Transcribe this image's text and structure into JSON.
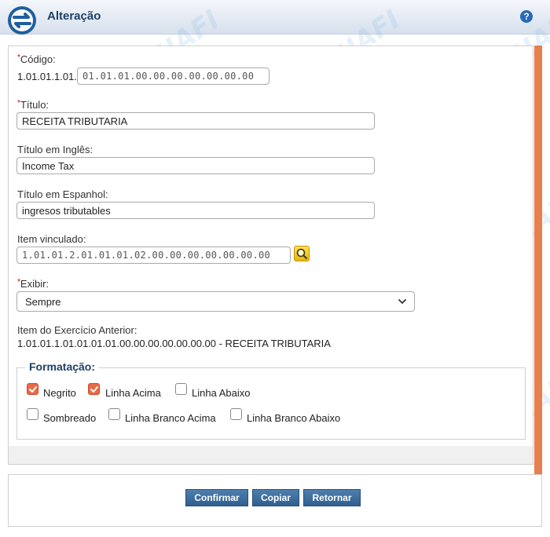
{
  "header": {
    "title": "Alteração",
    "help_label": "?"
  },
  "brand": {
    "watermark_text": "SIAFI",
    "accent_color": "#e87f4f",
    "title_color": "#1f3f66"
  },
  "form": {
    "codigo": {
      "label": "Código:",
      "prefix": "1.01.01.1.01.",
      "value": "01.01.01.00.00.00.00.00.00.00"
    },
    "titulo": {
      "label": "Título:",
      "value": "RECEITA TRIBUTARIA"
    },
    "titulo_ingles": {
      "label": "Título em Inglês:",
      "value": "Income Tax"
    },
    "titulo_espanhol": {
      "label": "Título em Espanhol:",
      "value": "ingresos tributables"
    },
    "item_vinculado": {
      "label": "Item vinculado:",
      "value": "1.01.01.2.01.01.01.02.00.00.00.00.00.00.00"
    },
    "exibir": {
      "label": "Exibir:",
      "value": "Sempre"
    },
    "item_anterior": {
      "label": "Item do Exercício Anterior:",
      "value": "1.01.01.1.01.01.01.01.00.00.00.00.00.00.00 - RECEITA TRIBUTARIA"
    },
    "required_mark": "*"
  },
  "formatacao": {
    "legend": "Formatação:",
    "options": [
      {
        "label": "Negrito",
        "checked": true
      },
      {
        "label": "Linha Acima",
        "checked": true
      },
      {
        "label": "Linha Abaixo",
        "checked": false
      },
      {
        "label": "Sombreado",
        "checked": false
      },
      {
        "label": "Linha Branco Acima",
        "checked": false
      },
      {
        "label": "Linha Branco Abaixo",
        "checked": false
      }
    ]
  },
  "buttons": {
    "confirmar": "Confirmar",
    "copiar": "Copiar",
    "retornar": "Retornar"
  }
}
